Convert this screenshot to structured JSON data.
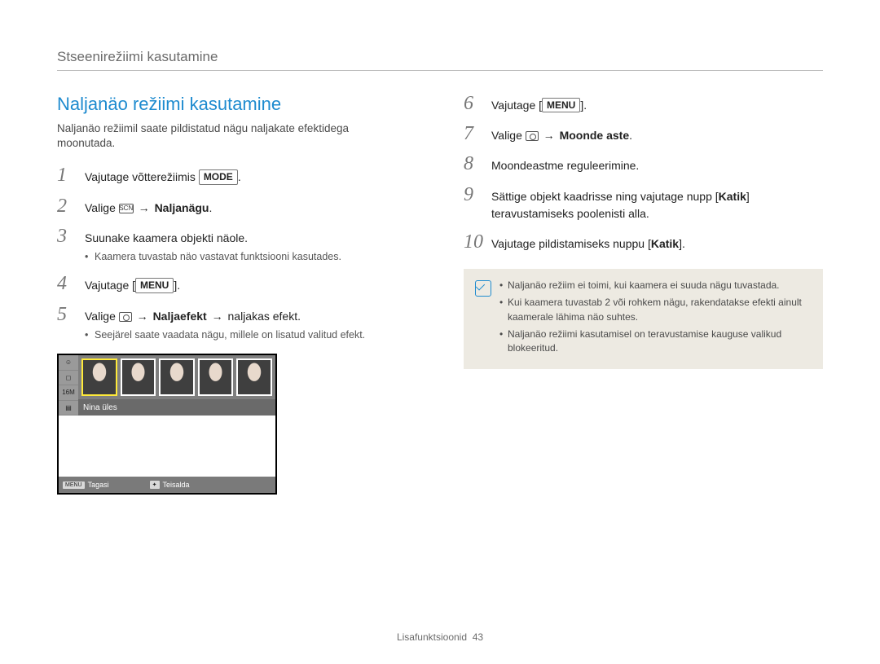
{
  "header": "Stseenirežiimi kasutamine",
  "section_title": "Naljanäo režiimi kasutamine",
  "intro": "Naljanäo režiimil saate pildistatud nägu naljakate efektidega moonutada.",
  "labels": {
    "mode": "MODE",
    "menu": "MENU"
  },
  "steps_left": [
    {
      "n": "1",
      "parts": [
        "Vajutage võtterežiimis ",
        {
          "box": "mode"
        },
        "."
      ]
    },
    {
      "n": "2",
      "parts": [
        "Valige ",
        {
          "icon": "scn-icon"
        },
        " ",
        {
          "arrow": true
        },
        " ",
        {
          "b": "Naljanägu"
        },
        "."
      ]
    },
    {
      "n": "3",
      "parts": [
        "Suunake kaamera objekti näole."
      ],
      "bullets": [
        "Kaamera tuvastab näo vastavat funktsiooni kasutades."
      ]
    },
    {
      "n": "4",
      "parts": [
        "Vajutage [",
        {
          "box": "menu"
        },
        "]."
      ]
    },
    {
      "n": "5",
      "parts": [
        "Valige ",
        {
          "icon": "camera-icon"
        },
        " ",
        {
          "arrow": true
        },
        " ",
        {
          "b": "Naljaefekt"
        },
        " ",
        {
          "arrow": true
        },
        " naljakas efekt."
      ],
      "bullets": [
        "Seejärel saate vaadata nägu, millele on lisatud valitud efekt."
      ]
    }
  ],
  "steps_right": [
    {
      "n": "6",
      "parts": [
        "Vajutage [",
        {
          "box": "menu"
        },
        "]."
      ]
    },
    {
      "n": "7",
      "parts": [
        "Valige ",
        {
          "icon": "camera-icon"
        },
        " ",
        {
          "arrow": true
        },
        " ",
        {
          "b": "Moonde aste"
        },
        "."
      ]
    },
    {
      "n": "8",
      "parts": [
        "Moondeastme reguleerimine."
      ]
    },
    {
      "n": "9",
      "parts": [
        "Sättige objekt kaadrisse ning vajutage nupp [",
        {
          "b": "Katik"
        },
        "] teravustamiseks poolenisti alla."
      ]
    },
    {
      "n": "10",
      "parts": [
        "Vajutage pildistamiseks nuppu [",
        {
          "b": "Katik"
        },
        "]."
      ]
    }
  ],
  "shot": {
    "caption": "Nina üles",
    "btn_menu": "MENU",
    "back": "Tagasi",
    "move": "Teisalda"
  },
  "notes": [
    "Naljanäo režiim ei toimi, kui kaamera ei suuda nägu tuvastada.",
    "Kui kaamera tuvastab 2 või rohkem nägu, rakendatakse efekti ainult kaamerale lähima näo suhtes.",
    "Naljanäo režiimi kasutamisel on teravustamise kauguse valikud blokeeritud."
  ],
  "footer": {
    "section": "Lisafunktsioonid",
    "page": "43"
  },
  "arrow_glyph": "→"
}
